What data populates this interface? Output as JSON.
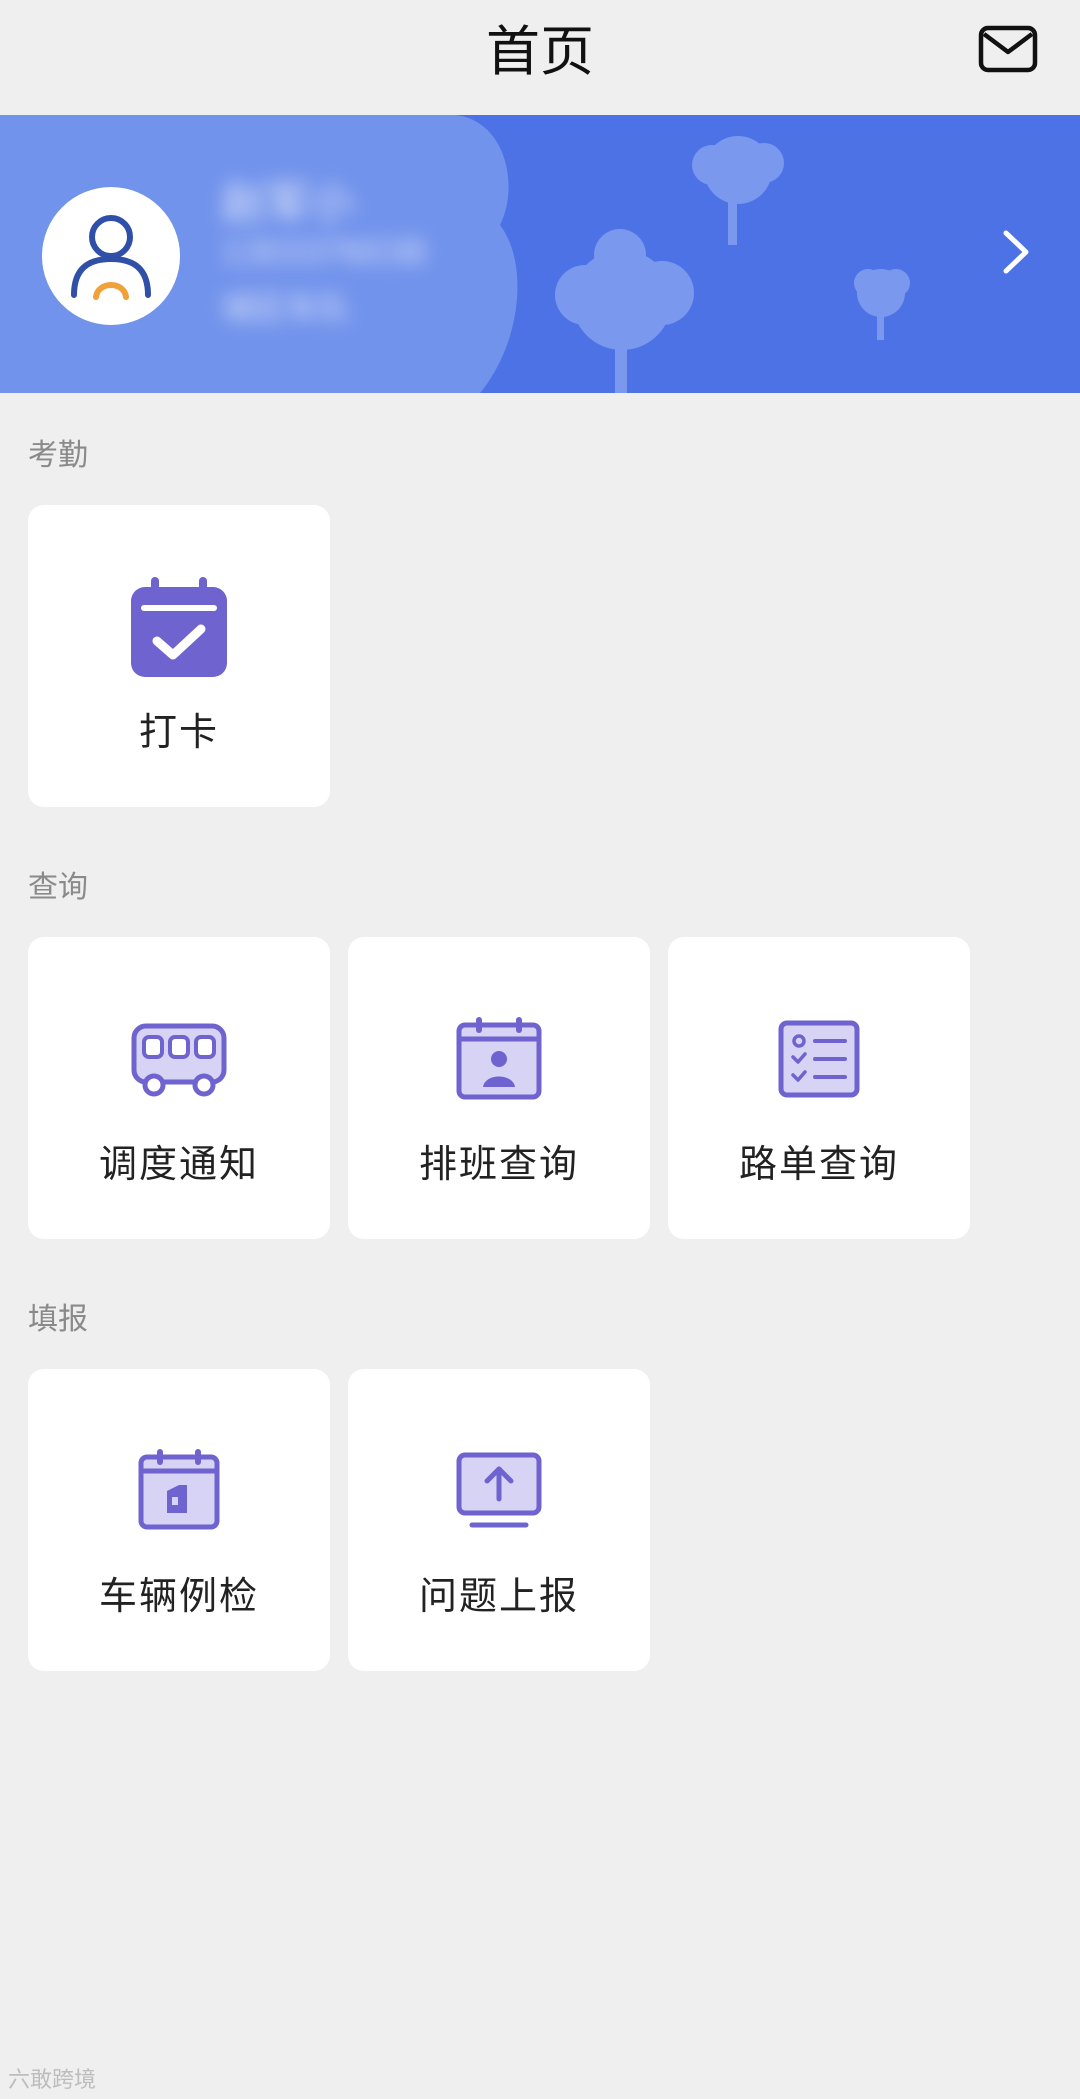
{
  "header": {
    "title": "首页",
    "mail_icon": "mail-icon"
  },
  "profile": {
    "name": "赵军小",
    "phone": "1303376038",
    "role": "城区车队",
    "banner_color": "#4d72e6",
    "chevron_icon": "chevron-right-icon"
  },
  "sections": {
    "attendance": {
      "label": "考勤",
      "items": [
        {
          "label": "打卡",
          "icon": "calendar-check-icon"
        }
      ]
    },
    "query": {
      "label": "查询",
      "items": [
        {
          "label": "调度通知",
          "icon": "bus-icon"
        },
        {
          "label": "排班查询",
          "icon": "schedule-icon"
        },
        {
          "label": "路单查询",
          "icon": "checklist-icon"
        }
      ]
    },
    "report": {
      "label": "填报",
      "items": [
        {
          "label": "车辆例检",
          "icon": "vehicle-inspection-icon"
        },
        {
          "label": "问题上报",
          "icon": "upload-icon"
        }
      ]
    }
  },
  "accent_color": "#6e63cf",
  "watermark": "六敢跨境"
}
